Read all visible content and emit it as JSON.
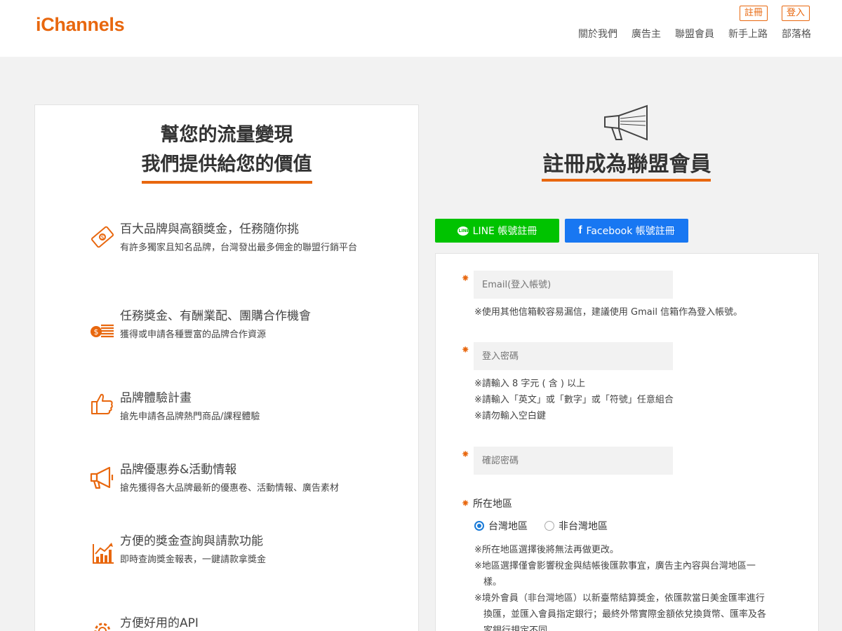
{
  "header": {
    "logo_i": "i",
    "logo_rest": "Channels",
    "register": "註冊",
    "login": "登入",
    "nav": [
      "關於我們",
      "廣告主",
      "聯盟會員",
      "新手上路",
      "部落格"
    ]
  },
  "left": {
    "title_line1": "幫您的流量變現",
    "title_line2": "我們提供給您的價值",
    "features": [
      {
        "icon": "money-bill-icon",
        "title": "百大品牌與高額獎金，任務隨你挑",
        "desc": "有許多獨家且知名品牌，台灣發出最多佣金的聯盟行銷平台"
      },
      {
        "icon": "coin-stack-icon",
        "title": "任務獎金、有酬業配、團購合作機會",
        "desc": "獲得或申請各種豐富的品牌合作資源"
      },
      {
        "icon": "thumbs-up-icon",
        "title": "品牌體驗計畫",
        "desc": "搶先申請各品牌熱門商品/課程體驗"
      },
      {
        "icon": "megaphone-icon",
        "title": "品牌優惠券&活動情報",
        "desc": "搶先獲得各大品牌最新的優惠卷、活動情報、廣告素材"
      },
      {
        "icon": "chart-up-icon",
        "title": "方便的獎金查詢與請款功能",
        "desc": "即時查詢獎金報表，一鍵請款拿獎金"
      },
      {
        "icon": "gear-icon",
        "title": "方便好用的API",
        "desc": ""
      }
    ]
  },
  "right": {
    "title": "註冊成為聯盟會員",
    "line_button": "LINE 帳號註冊",
    "facebook_button": "Facebook 帳號註冊"
  },
  "form": {
    "star": "⁕",
    "email_placeholder": "Email(登入帳號)",
    "email_note": "※使用其他信箱較容易漏信，建議使用 Gmail 信箱作為登入帳號。",
    "password_placeholder": "登入密碼",
    "password_notes": [
      "※請輸入 8 字元 ( 含 ) 以上",
      "※請輸入「英文」或「數字」或「符號」任意組合",
      "※請勿輸入空白鍵"
    ],
    "confirm_placeholder": "確認密碼",
    "region_label": "所在地區",
    "region_options": [
      "台灣地區",
      "非台灣地區"
    ],
    "region_selected": "台灣地區",
    "region_notes": [
      "※所在地區選擇後將無法再做更改。",
      "※地區選擇僅會影響稅金與結帳後匯款事宜，廣告主內容與台灣地區一",
      "　樣。",
      "※境外會員（非台灣地區）以新臺幣結算獎金，依匯款當日美金匯率進行",
      "　換匯，並匯入會員指定銀行；最終外幣實際金額依兌換貨幣、匯率及各",
      "　家銀行規定不同。"
    ]
  },
  "colors": {
    "accent": "#e8670e",
    "line_green": "#00c300",
    "facebook_blue": "#1877f2",
    "radio_blue": "#1a7bd8"
  }
}
